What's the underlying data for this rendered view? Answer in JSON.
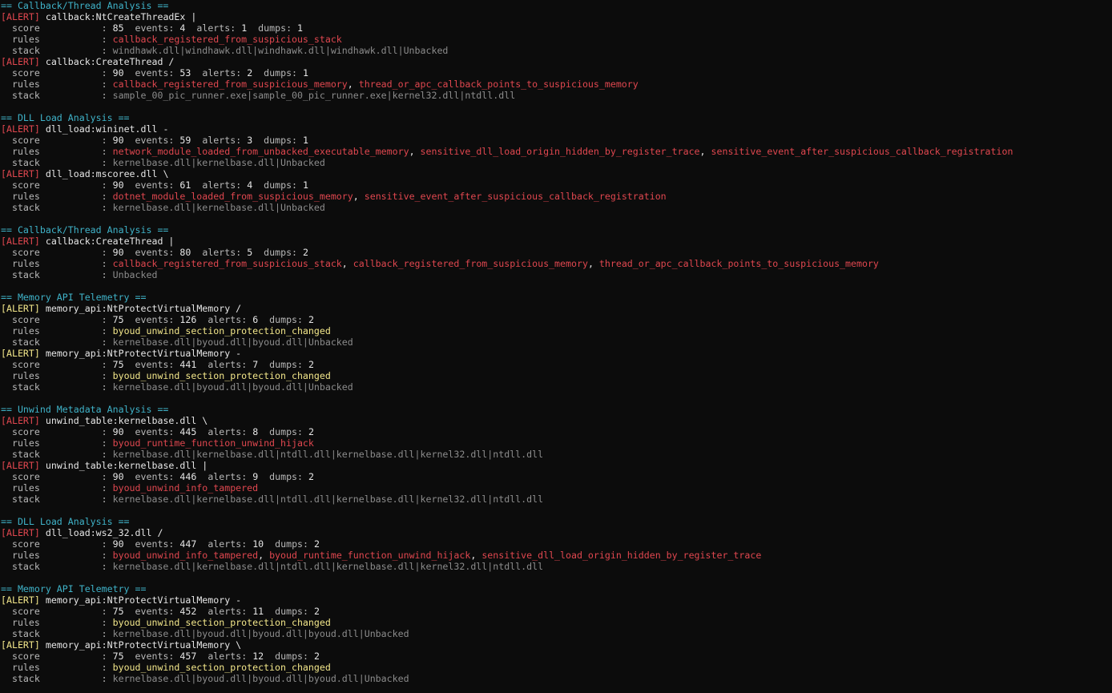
{
  "terminal": {
    "colors": {
      "background": "#0c0c0c",
      "section_header": "#3fb3c9",
      "alert_high": "#e0474f",
      "alert_medium": "#f2e68a",
      "text": "#cccccc",
      "stack": "#8c8c8c"
    },
    "lines": [
      {
        "type": "header",
        "text": "== Callback/Thread Analysis =="
      },
      {
        "type": "alert",
        "severity": "high",
        "tag": "[ALERT]",
        "title": "callback:NtCreateThreadEx |"
      },
      {
        "type": "score",
        "label": "  score           : ",
        "score": "85",
        "events": "4",
        "alerts": "1",
        "dumps": "1"
      },
      {
        "type": "rules",
        "severity": "high",
        "label": "  rules           : ",
        "rules": [
          "callback_registered_from_suspicious_stack"
        ]
      },
      {
        "type": "stack",
        "label": "  stack           : ",
        "stack": "windhawk.dll|windhawk.dll|windhawk.dll|windhawk.dll|Unbacked"
      },
      {
        "type": "alert",
        "severity": "high",
        "tag": "[ALERT]",
        "title": "callback:CreateThread /"
      },
      {
        "type": "score",
        "label": "  score           : ",
        "score": "90",
        "events": "53",
        "alerts": "2",
        "dumps": "1"
      },
      {
        "type": "rules",
        "severity": "high",
        "label": "  rules           : ",
        "rules": [
          "callback_registered_from_suspicious_memory",
          "thread_or_apc_callback_points_to_suspicious_memory"
        ]
      },
      {
        "type": "stack",
        "label": "  stack           : ",
        "stack": "sample_00_pic_runner.exe|sample_00_pic_runner.exe|kernel32.dll|ntdll.dll"
      },
      {
        "type": "blank"
      },
      {
        "type": "header",
        "text": "== DLL Load Analysis =="
      },
      {
        "type": "alert",
        "severity": "high",
        "tag": "[ALERT]",
        "title": "dll_load:wininet.dll -"
      },
      {
        "type": "score",
        "label": "  score           : ",
        "score": "90",
        "events": "59",
        "alerts": "3",
        "dumps": "1"
      },
      {
        "type": "rules",
        "severity": "high",
        "label": "  rules           : ",
        "rules": [
          "network_module_loaded_from_unbacked_executable_memory",
          "sensitive_dll_load_origin_hidden_by_register_trace",
          "sensitive_event_after_suspicious_callback_registration"
        ]
      },
      {
        "type": "stack",
        "label": "  stack           : ",
        "stack": "kernelbase.dll|kernelbase.dll|Unbacked"
      },
      {
        "type": "alert",
        "severity": "high",
        "tag": "[ALERT]",
        "title": "dll_load:mscoree.dll \\"
      },
      {
        "type": "score",
        "label": "  score           : ",
        "score": "90",
        "events": "61",
        "alerts": "4",
        "dumps": "1"
      },
      {
        "type": "rules",
        "severity": "high",
        "label": "  rules           : ",
        "rules": [
          "dotnet_module_loaded_from_suspicious_memory",
          "sensitive_event_after_suspicious_callback_registration"
        ]
      },
      {
        "type": "stack",
        "label": "  stack           : ",
        "stack": "kernelbase.dll|kernelbase.dll|Unbacked"
      },
      {
        "type": "blank"
      },
      {
        "type": "header",
        "text": "== Callback/Thread Analysis =="
      },
      {
        "type": "alert",
        "severity": "high",
        "tag": "[ALERT]",
        "title": "callback:CreateThread |"
      },
      {
        "type": "score",
        "label": "  score           : ",
        "score": "90",
        "events": "80",
        "alerts": "5",
        "dumps": "2"
      },
      {
        "type": "rules",
        "severity": "high",
        "label": "  rules           : ",
        "rules": [
          "callback_registered_from_suspicious_stack",
          "callback_registered_from_suspicious_memory",
          "thread_or_apc_callback_points_to_suspicious_memory"
        ]
      },
      {
        "type": "stack",
        "label": "  stack           : ",
        "stack": "Unbacked"
      },
      {
        "type": "blank"
      },
      {
        "type": "header",
        "text": "== Memory API Telemetry =="
      },
      {
        "type": "alert",
        "severity": "medium",
        "tag": "[ALERT]",
        "title": "memory_api:NtProtectVirtualMemory /"
      },
      {
        "type": "score",
        "label": "  score           : ",
        "score": "75",
        "events": "126",
        "alerts": "6",
        "dumps": "2"
      },
      {
        "type": "rules",
        "severity": "medium",
        "label": "  rules           : ",
        "rules": [
          "byoud_unwind_section_protection_changed"
        ]
      },
      {
        "type": "stack",
        "label": "  stack           : ",
        "stack": "kernelbase.dll|byoud.dll|byoud.dll|Unbacked"
      },
      {
        "type": "alert",
        "severity": "medium",
        "tag": "[ALERT]",
        "title": "memory_api:NtProtectVirtualMemory -"
      },
      {
        "type": "score",
        "label": "  score           : ",
        "score": "75",
        "events": "441",
        "alerts": "7",
        "dumps": "2"
      },
      {
        "type": "rules",
        "severity": "medium",
        "label": "  rules           : ",
        "rules": [
          "byoud_unwind_section_protection_changed"
        ]
      },
      {
        "type": "stack",
        "label": "  stack           : ",
        "stack": "kernelbase.dll|byoud.dll|byoud.dll|Unbacked"
      },
      {
        "type": "blank"
      },
      {
        "type": "header",
        "text": "== Unwind Metadata Analysis =="
      },
      {
        "type": "alert",
        "severity": "high",
        "tag": "[ALERT]",
        "title": "unwind_table:kernelbase.dll \\"
      },
      {
        "type": "score",
        "label": "  score           : ",
        "score": "90",
        "events": "445",
        "alerts": "8",
        "dumps": "2"
      },
      {
        "type": "rules",
        "severity": "high",
        "label": "  rules           : ",
        "rules": [
          "byoud_runtime_function_unwind_hijack"
        ]
      },
      {
        "type": "stack",
        "label": "  stack           : ",
        "stack": "kernelbase.dll|kernelbase.dll|ntdll.dll|kernelbase.dll|kernel32.dll|ntdll.dll"
      },
      {
        "type": "alert",
        "severity": "high",
        "tag": "[ALERT]",
        "title": "unwind_table:kernelbase.dll |"
      },
      {
        "type": "score",
        "label": "  score           : ",
        "score": "90",
        "events": "446",
        "alerts": "9",
        "dumps": "2"
      },
      {
        "type": "rules",
        "severity": "high",
        "label": "  rules           : ",
        "rules": [
          "byoud_unwind_info_tampered"
        ]
      },
      {
        "type": "stack",
        "label": "  stack           : ",
        "stack": "kernelbase.dll|kernelbase.dll|ntdll.dll|kernelbase.dll|kernel32.dll|ntdll.dll"
      },
      {
        "type": "blank"
      },
      {
        "type": "header",
        "text": "== DLL Load Analysis =="
      },
      {
        "type": "alert",
        "severity": "high",
        "tag": "[ALERT]",
        "title": "dll_load:ws2_32.dll /"
      },
      {
        "type": "score",
        "label": "  score           : ",
        "score": "90",
        "events": "447",
        "alerts": "10",
        "dumps": "2"
      },
      {
        "type": "rules",
        "severity": "high",
        "label": "  rules           : ",
        "rules": [
          "byoud_unwind_info_tampered",
          "byoud_runtime_function_unwind_hijack",
          "sensitive_dll_load_origin_hidden_by_register_trace"
        ]
      },
      {
        "type": "stack",
        "label": "  stack           : ",
        "stack": "kernelbase.dll|kernelbase.dll|ntdll.dll|kernelbase.dll|kernel32.dll|ntdll.dll"
      },
      {
        "type": "blank"
      },
      {
        "type": "header",
        "text": "== Memory API Telemetry =="
      },
      {
        "type": "alert",
        "severity": "medium",
        "tag": "[ALERT]",
        "title": "memory_api:NtProtectVirtualMemory -"
      },
      {
        "type": "score",
        "label": "  score           : ",
        "score": "75",
        "events": "452",
        "alerts": "11",
        "dumps": "2"
      },
      {
        "type": "rules",
        "severity": "medium",
        "label": "  rules           : ",
        "rules": [
          "byoud_unwind_section_protection_changed"
        ]
      },
      {
        "type": "stack",
        "label": "  stack           : ",
        "stack": "kernelbase.dll|byoud.dll|byoud.dll|byoud.dll|Unbacked"
      },
      {
        "type": "alert",
        "severity": "medium",
        "tag": "[ALERT]",
        "title": "memory_api:NtProtectVirtualMemory \\"
      },
      {
        "type": "score",
        "label": "  score           : ",
        "score": "75",
        "events": "457",
        "alerts": "12",
        "dumps": "2"
      },
      {
        "type": "rules",
        "severity": "medium",
        "label": "  rules           : ",
        "rules": [
          "byoud_unwind_section_protection_changed"
        ]
      },
      {
        "type": "stack",
        "label": "  stack           : ",
        "stack": "kernelbase.dll|byoud.dll|byoud.dll|byoud.dll|Unbacked"
      }
    ]
  }
}
